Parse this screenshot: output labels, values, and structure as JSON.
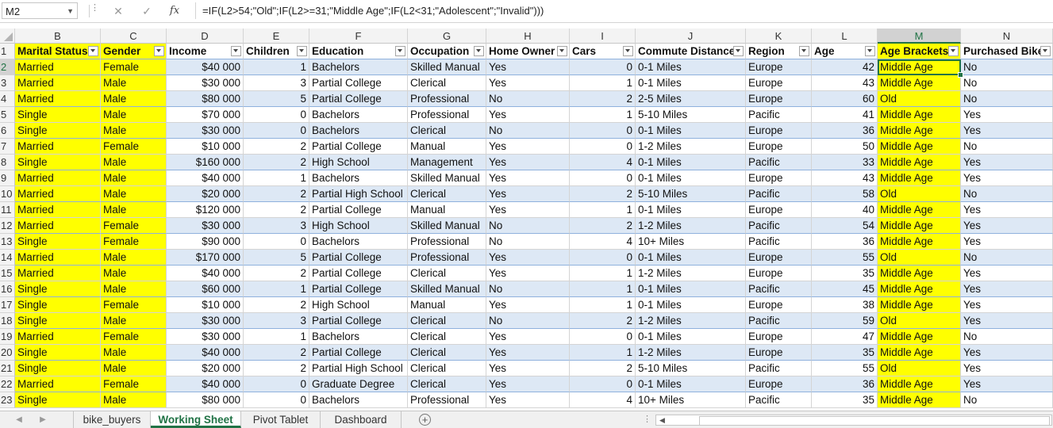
{
  "formula_bar": {
    "name_box": "M2",
    "cancel_icon": "✕",
    "enter_icon": "✓",
    "fx_label": "fx",
    "formula": "=IF(L2>54;\"Old\";IF(L2>=31;\"Middle Age\";IF(L2<31;\"Adolescent\";\"Invalid\")))"
  },
  "column_letters": [
    "B",
    "C",
    "D",
    "E",
    "F",
    "G",
    "H",
    "I",
    "J",
    "K",
    "L",
    "M",
    "N"
  ],
  "headers": [
    "Marital Status",
    "Gender",
    "Income",
    "Children",
    "Education",
    "Occupation",
    "Home Owner",
    "Cars",
    "Commute Distance",
    "Region",
    "Age",
    "Age Brackets",
    "Purchased Bike"
  ],
  "rows": [
    [
      "2",
      "Married",
      "Female",
      "$40 000",
      "1",
      "Bachelors",
      "Skilled Manual",
      "Yes",
      "0",
      "0-1 Miles",
      "Europe",
      "42",
      "Middle Age",
      "No"
    ],
    [
      "3",
      "Married",
      "Male",
      "$30 000",
      "3",
      "Partial College",
      "Clerical",
      "Yes",
      "1",
      "0-1 Miles",
      "Europe",
      "43",
      "Middle Age",
      "No"
    ],
    [
      "4",
      "Married",
      "Male",
      "$80 000",
      "5",
      "Partial College",
      "Professional",
      "No",
      "2",
      "2-5 Miles",
      "Europe",
      "60",
      "Old",
      "No"
    ],
    [
      "5",
      "Single",
      "Male",
      "$70 000",
      "0",
      "Bachelors",
      "Professional",
      "Yes",
      "1",
      "5-10 Miles",
      "Pacific",
      "41",
      "Middle Age",
      "Yes"
    ],
    [
      "6",
      "Single",
      "Male",
      "$30 000",
      "0",
      "Bachelors",
      "Clerical",
      "No",
      "0",
      "0-1 Miles",
      "Europe",
      "36",
      "Middle Age",
      "Yes"
    ],
    [
      "7",
      "Married",
      "Female",
      "$10 000",
      "2",
      "Partial College",
      "Manual",
      "Yes",
      "0",
      "1-2 Miles",
      "Europe",
      "50",
      "Middle Age",
      "No"
    ],
    [
      "8",
      "Single",
      "Male",
      "$160 000",
      "2",
      "High School",
      "Management",
      "Yes",
      "4",
      "0-1 Miles",
      "Pacific",
      "33",
      "Middle Age",
      "Yes"
    ],
    [
      "9",
      "Married",
      "Male",
      "$40 000",
      "1",
      "Bachelors",
      "Skilled Manual",
      "Yes",
      "0",
      "0-1 Miles",
      "Europe",
      "43",
      "Middle Age",
      "Yes"
    ],
    [
      "10",
      "Married",
      "Male",
      "$20 000",
      "2",
      "Partial High School",
      "Clerical",
      "Yes",
      "2",
      "5-10 Miles",
      "Pacific",
      "58",
      "Old",
      "No"
    ],
    [
      "11",
      "Married",
      "Male",
      "$120 000",
      "2",
      "Partial College",
      "Manual",
      "Yes",
      "1",
      "0-1 Miles",
      "Europe",
      "40",
      "Middle Age",
      "Yes"
    ],
    [
      "12",
      "Married",
      "Female",
      "$30 000",
      "3",
      "High School",
      "Skilled Manual",
      "No",
      "2",
      "1-2 Miles",
      "Pacific",
      "54",
      "Middle Age",
      "Yes"
    ],
    [
      "13",
      "Single",
      "Female",
      "$90 000",
      "0",
      "Bachelors",
      "Professional",
      "No",
      "4",
      "10+ Miles",
      "Pacific",
      "36",
      "Middle Age",
      "Yes"
    ],
    [
      "14",
      "Married",
      "Male",
      "$170 000",
      "5",
      "Partial College",
      "Professional",
      "Yes",
      "0",
      "0-1 Miles",
      "Europe",
      "55",
      "Old",
      "No"
    ],
    [
      "15",
      "Married",
      "Male",
      "$40 000",
      "2",
      "Partial College",
      "Clerical",
      "Yes",
      "1",
      "1-2 Miles",
      "Europe",
      "35",
      "Middle Age",
      "Yes"
    ],
    [
      "16",
      "Single",
      "Male",
      "$60 000",
      "1",
      "Partial College",
      "Skilled Manual",
      "No",
      "1",
      "0-1 Miles",
      "Pacific",
      "45",
      "Middle Age",
      "Yes"
    ],
    [
      "17",
      "Single",
      "Female",
      "$10 000",
      "2",
      "High School",
      "Manual",
      "Yes",
      "1",
      "0-1 Miles",
      "Europe",
      "38",
      "Middle Age",
      "Yes"
    ],
    [
      "18",
      "Single",
      "Male",
      "$30 000",
      "3",
      "Partial College",
      "Clerical",
      "No",
      "2",
      "1-2 Miles",
      "Pacific",
      "59",
      "Old",
      "Yes"
    ],
    [
      "19",
      "Married",
      "Female",
      "$30 000",
      "1",
      "Bachelors",
      "Clerical",
      "Yes",
      "0",
      "0-1 Miles",
      "Europe",
      "47",
      "Middle Age",
      "No"
    ],
    [
      "20",
      "Single",
      "Male",
      "$40 000",
      "2",
      "Partial College",
      "Clerical",
      "Yes",
      "1",
      "1-2 Miles",
      "Europe",
      "35",
      "Middle Age",
      "Yes"
    ],
    [
      "21",
      "Single",
      "Male",
      "$20 000",
      "2",
      "Partial High School",
      "Clerical",
      "Yes",
      "2",
      "5-10 Miles",
      "Pacific",
      "55",
      "Old",
      "Yes"
    ],
    [
      "22",
      "Married",
      "Female",
      "$40 000",
      "0",
      "Graduate Degree",
      "Clerical",
      "Yes",
      "0",
      "0-1 Miles",
      "Europe",
      "36",
      "Middle Age",
      "Yes"
    ],
    [
      "23",
      "Single",
      "Male",
      "$80 000",
      "0",
      "Bachelors",
      "Professional",
      "Yes",
      "4",
      "10+ Miles",
      "Pacific",
      "35",
      "Middle Age",
      "No"
    ]
  ],
  "header_row_number": "1",
  "sheet_tabs": [
    "bike_buyers",
    "Working Sheet",
    "Pivot Tablet",
    "Dashboard"
  ],
  "active_sheet": "Working Sheet",
  "add_sheet_label": "+",
  "colors": {
    "highlight": "#ffff00",
    "band": "#dde8f5",
    "excel_green": "#217346"
  }
}
